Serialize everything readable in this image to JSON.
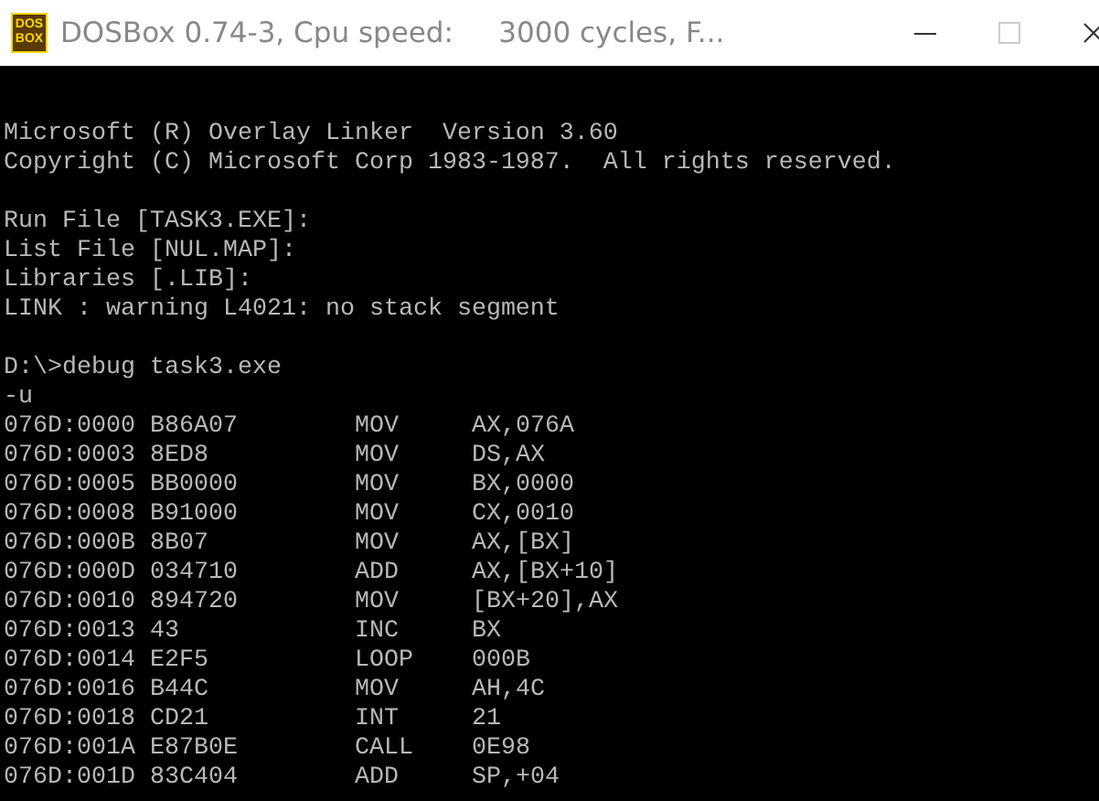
{
  "window": {
    "title": "DOSBox 0.74-3, Cpu speed:     3000 cycles, F...",
    "logo_text": [
      "DOS",
      "BOX"
    ]
  },
  "terminal": {
    "paragraphs": [
      [
        "Microsoft (R) Overlay Linker  Version 3.60",
        "Copyright (C) Microsoft Corp 1983-1987.  All rights reserved."
      ],
      [
        "Run File [TASK3.EXE]:",
        "List File [NUL.MAP]:",
        "Libraries [.LIB]:",
        "LINK : warning L4021: no stack segment"
      ],
      [
        "D:\\>debug task3.exe",
        "-u"
      ]
    ],
    "disassembly": [
      {
        "address": "076D:0000",
        "bytes": "B86A07",
        "mnemonic": "MOV",
        "operand": "AX,076A"
      },
      {
        "address": "076D:0003",
        "bytes": "8ED8",
        "mnemonic": "MOV",
        "operand": "DS,AX"
      },
      {
        "address": "076D:0005",
        "bytes": "BB0000",
        "mnemonic": "MOV",
        "operand": "BX,0000"
      },
      {
        "address": "076D:0008",
        "bytes": "B91000",
        "mnemonic": "MOV",
        "operand": "CX,0010"
      },
      {
        "address": "076D:000B",
        "bytes": "8B07",
        "mnemonic": "MOV",
        "operand": "AX,[BX]"
      },
      {
        "address": "076D:000D",
        "bytes": "034710",
        "mnemonic": "ADD",
        "operand": "AX,[BX+10]"
      },
      {
        "address": "076D:0010",
        "bytes": "894720",
        "mnemonic": "MOV",
        "operand": "[BX+20],AX"
      },
      {
        "address": "076D:0013",
        "bytes": "43",
        "mnemonic": "INC",
        "operand": "BX"
      },
      {
        "address": "076D:0014",
        "bytes": "E2F5",
        "mnemonic": "LOOP",
        "operand": "000B"
      },
      {
        "address": "076D:0016",
        "bytes": "B44C",
        "mnemonic": "MOV",
        "operand": "AH,4C"
      },
      {
        "address": "076D:0018",
        "bytes": "CD21",
        "mnemonic": "INT",
        "operand": "21"
      },
      {
        "address": "076D:001A",
        "bytes": "E87B0E",
        "mnemonic": "CALL",
        "operand": "0E98"
      },
      {
        "address": "076D:001D",
        "bytes": "83C404",
        "mnemonic": "ADD",
        "operand": "SP,+04"
      }
    ]
  }
}
